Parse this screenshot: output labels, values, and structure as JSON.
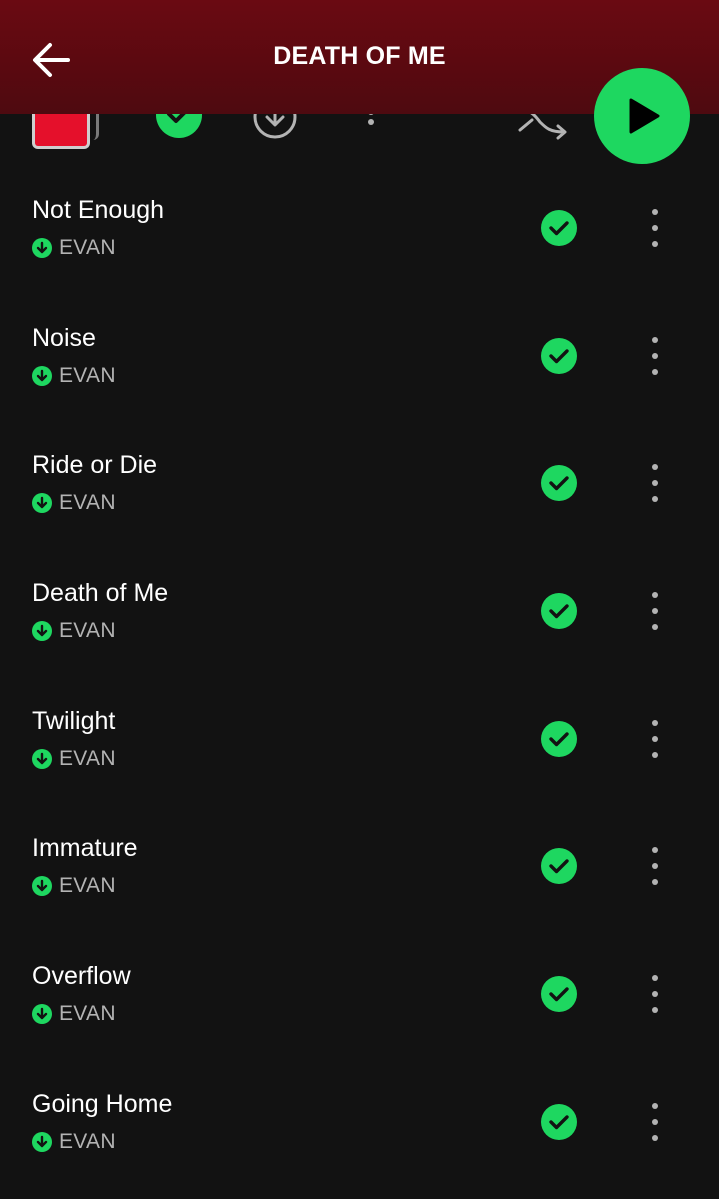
{
  "header": {
    "title": "DEATH OF ME"
  },
  "colors": {
    "accent": "#1ed760",
    "header_bg": "#5a0910",
    "background": "#121212",
    "cover": "#e5102b"
  },
  "icons": {
    "back": "arrow-left-icon",
    "saved": "check-circle-icon",
    "download": "download-circle-icon",
    "more": "more-vertical-icon",
    "shuffle": "shuffle-icon",
    "play": "play-icon"
  },
  "tracks": [
    {
      "title": "Not Enough",
      "artist": "EVAN"
    },
    {
      "title": "Noise",
      "artist": "EVAN"
    },
    {
      "title": "Ride or Die",
      "artist": "EVAN"
    },
    {
      "title": "Death of Me",
      "artist": "EVAN"
    },
    {
      "title": "Twilight",
      "artist": "EVAN"
    },
    {
      "title": "Immature",
      "artist": "EVAN"
    },
    {
      "title": "Overflow",
      "artist": "EVAN"
    },
    {
      "title": "Going Home",
      "artist": "EVAN"
    }
  ]
}
